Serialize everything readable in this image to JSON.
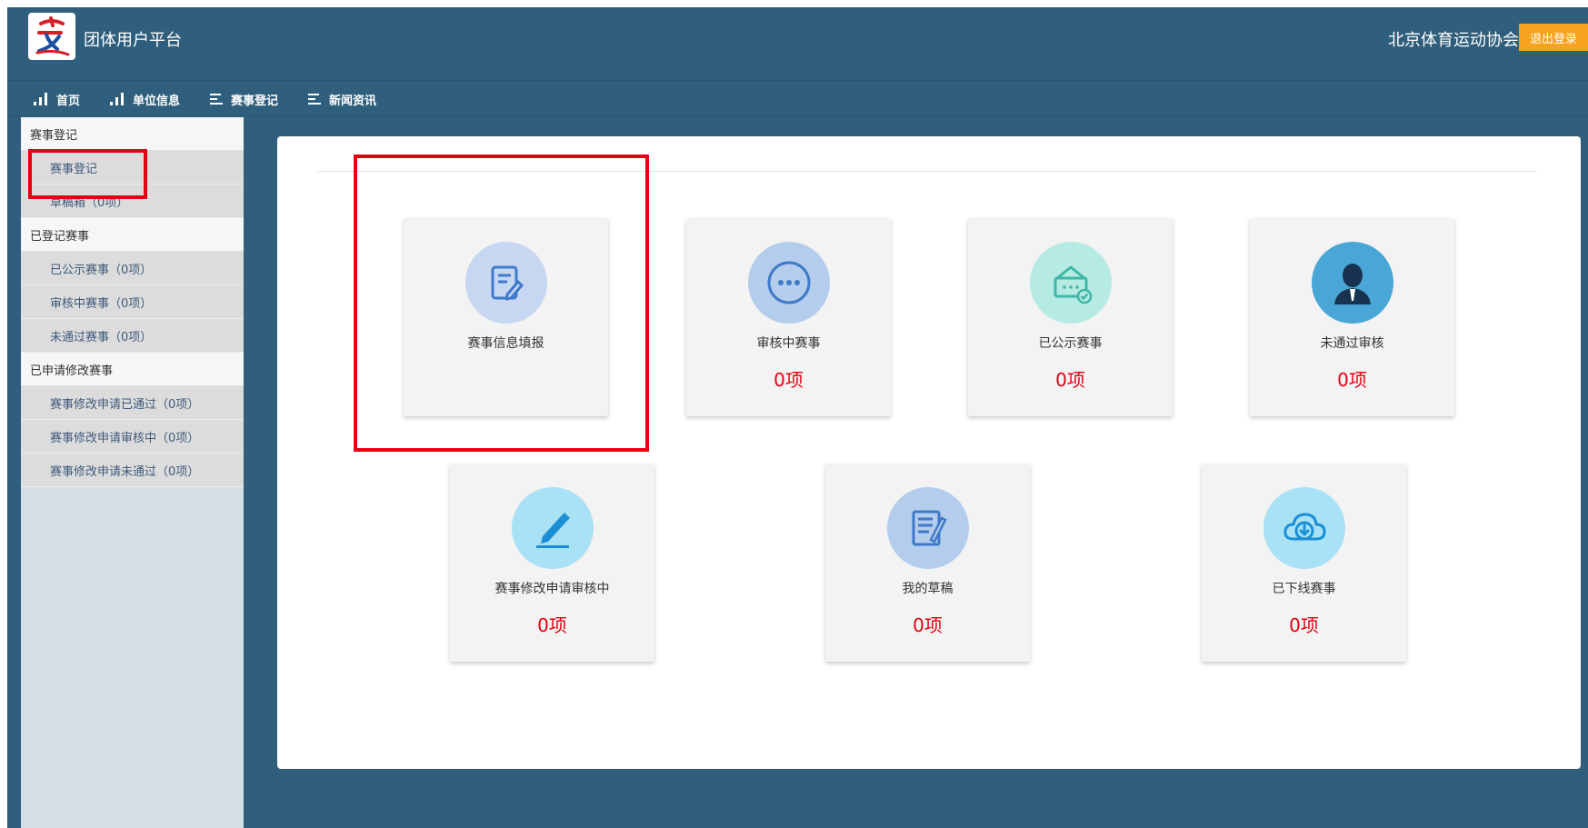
{
  "header": {
    "app_title": "团体用户平台",
    "org_name": "北京体育运动协会",
    "logout_label": "退出登录"
  },
  "nav": {
    "items": [
      {
        "label": "首页",
        "icon": "bar-chart-icon"
      },
      {
        "label": "单位信息",
        "icon": "bar-chart-icon"
      },
      {
        "label": "赛事登记",
        "icon": "list-icon"
      },
      {
        "label": "新闻资讯",
        "icon": "list-icon"
      }
    ]
  },
  "sidebar": {
    "groups": [
      {
        "title": "赛事登记",
        "items": [
          "赛事登记",
          "草稿箱（0项）"
        ]
      },
      {
        "title": "已登记赛事",
        "items": [
          "已公示赛事（0项）",
          "审核中赛事（0项）",
          "未通过赛事（0项）"
        ]
      },
      {
        "title": "已申请修改赛事",
        "items": [
          "赛事修改申请已通过（0项）",
          "赛事修改申请审核中（0项）",
          "赛事修改申请未通过（0项）"
        ]
      }
    ]
  },
  "cards": [
    {
      "label": "赛事信息填报",
      "count": "",
      "icon": "form-edit-icon",
      "color": "#c7d7f2"
    },
    {
      "label": "审核中赛事",
      "count": "0项",
      "icon": "more-dots-icon",
      "color": "#b4cdec"
    },
    {
      "label": "已公示赛事",
      "count": "0项",
      "icon": "announcement-icon",
      "color": "#b6ebe3"
    },
    {
      "label": "未通过审核",
      "count": "0项",
      "icon": "user-icon",
      "color": "#4aa6d6"
    },
    {
      "label": "赛事修改申请审核中",
      "count": "0项",
      "icon": "pen-icon",
      "color": "#a9e1f5"
    },
    {
      "label": "我的草稿",
      "count": "0项",
      "icon": "draft-icon",
      "color": "#b4cdec"
    },
    {
      "label": "已下线赛事",
      "count": "0项",
      "icon": "cloud-download-icon",
      "color": "#a9e1f5"
    }
  ],
  "colors": {
    "background": "#2f5f7c",
    "accent": "#f5a21f",
    "highlight": "#e60012"
  }
}
